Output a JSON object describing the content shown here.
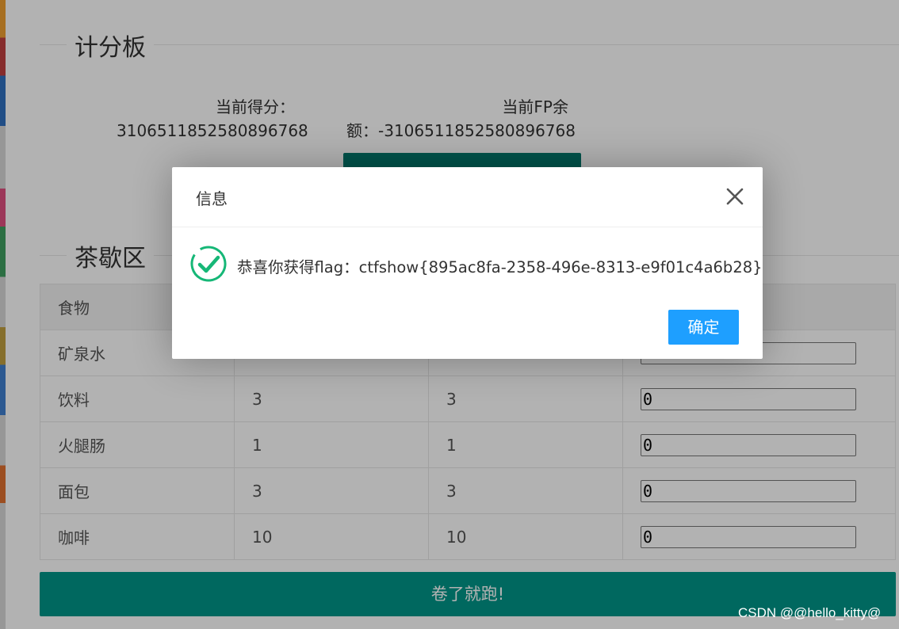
{
  "scoreboard": {
    "legend": "计分板",
    "score_label": "当前得分：",
    "score_value": "310651185258089676 8",
    "fp_label": "当前FP余",
    "fp_value": "额：-310651185258089676 8"
  },
  "shop": {
    "legend": "茶歇区",
    "header_col1": "食物",
    "rows": [
      {
        "name": "矿泉水",
        "col2": "",
        "col3": "",
        "qty": ""
      },
      {
        "name": "饮料",
        "col2": "3",
        "col3": "3",
        "qty": "0"
      },
      {
        "name": "火腿肠",
        "col2": "1",
        "col3": "1",
        "qty": "0"
      },
      {
        "name": "面包",
        "col2": "3",
        "col3": "3",
        "qty": "0"
      },
      {
        "name": "咖啡",
        "col2": "10",
        "col3": "10",
        "qty": "0"
      }
    ],
    "run_button": "卷了就跑!"
  },
  "dialog": {
    "title": "信息",
    "message": "恭喜你获得flag：ctfshow{895ac8fa-2358-496e-8313-e9f01c4a6b28}",
    "ok_label": "确定",
    "icon": "success-check-icon",
    "close_icon": "close-icon"
  },
  "watermark": "CSDN @@hello_kitty@",
  "colors": {
    "primary_green": "#009688",
    "dialog_button_blue": "#1e9fff",
    "check_icon_teal": "#16b777"
  }
}
